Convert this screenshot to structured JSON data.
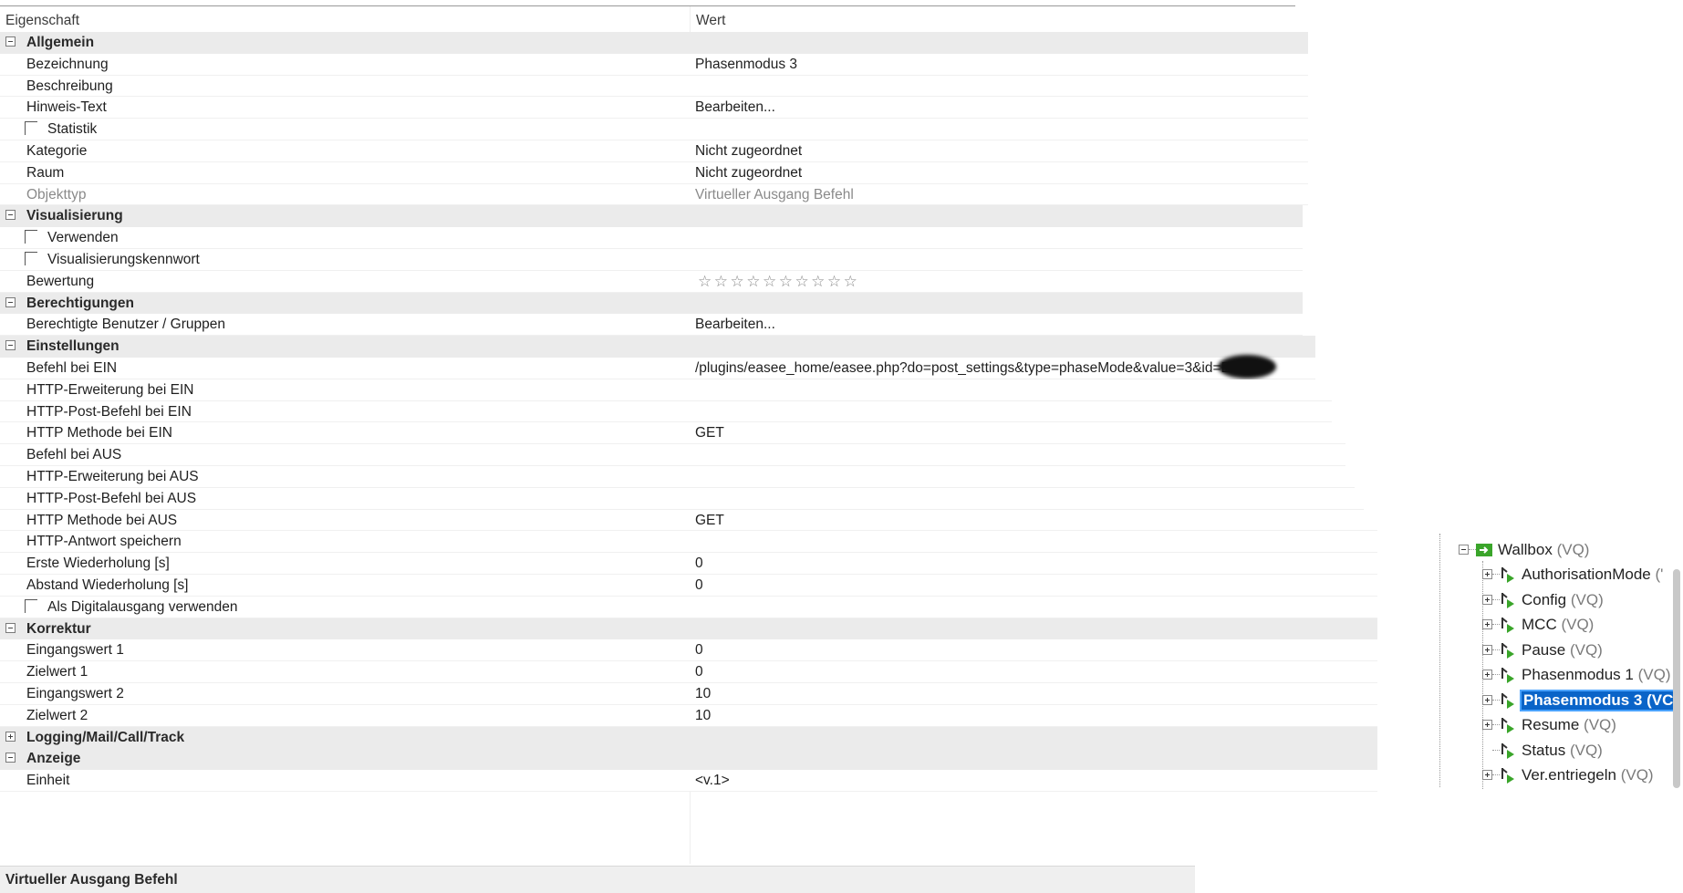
{
  "header": {
    "col_property": "Eigenschaft",
    "col_value": "Wert"
  },
  "rows": [
    {
      "type": "section",
      "label": "Allgemein",
      "expanded": true
    },
    {
      "type": "prop",
      "label": "Bezeichnung",
      "value": "Phasenmodus 3"
    },
    {
      "type": "prop",
      "label": "Beschreibung",
      "value": ""
    },
    {
      "type": "prop",
      "label": "Hinweis-Text",
      "value": "Bearbeiten..."
    },
    {
      "type": "check",
      "label": "Statistik",
      "value": ""
    },
    {
      "type": "prop",
      "label": "Kategorie",
      "value": "Nicht zugeordnet"
    },
    {
      "type": "prop",
      "label": "Raum",
      "value": "Nicht zugeordnet"
    },
    {
      "type": "prop",
      "label": "Objekttyp",
      "value": "Virtueller Ausgang Befehl",
      "disabled": true
    },
    {
      "type": "section",
      "label": "Visualisierung",
      "expanded": true
    },
    {
      "type": "check",
      "label": "Verwenden",
      "value": ""
    },
    {
      "type": "check",
      "label": "Visualisierungskennwort",
      "value": ""
    },
    {
      "type": "rating",
      "label": "Bewertung",
      "value": "☆☆☆☆☆☆☆☆☆☆"
    },
    {
      "type": "section",
      "label": "Berechtigungen",
      "expanded": true
    },
    {
      "type": "prop",
      "label": "Berechtigte Benutzer / Gruppen",
      "value": "Bearbeiten..."
    },
    {
      "type": "section",
      "label": "Einstellungen",
      "expanded": true
    },
    {
      "type": "prop",
      "label": "Befehl bei EIN",
      "value": "/plugins/easee_home/easee.php?do=post_settings&type=phaseMode&value=3&id=EH",
      "redacted": true
    },
    {
      "type": "prop",
      "label": "HTTP-Erweiterung bei EIN",
      "value": ""
    },
    {
      "type": "prop",
      "label": "HTTP-Post-Befehl bei EIN",
      "value": ""
    },
    {
      "type": "prop",
      "label": "HTTP Methode bei EIN",
      "value": "GET"
    },
    {
      "type": "prop",
      "label": "Befehl bei AUS",
      "value": ""
    },
    {
      "type": "prop",
      "label": "HTTP-Erweiterung bei AUS",
      "value": ""
    },
    {
      "type": "prop",
      "label": "HTTP-Post-Befehl bei AUS",
      "value": ""
    },
    {
      "type": "prop",
      "label": "HTTP Methode bei AUS",
      "value": "GET"
    },
    {
      "type": "prop",
      "label": "HTTP-Antwort speichern",
      "value": ""
    },
    {
      "type": "prop",
      "label": "Erste Wiederholung [s]",
      "value": "0"
    },
    {
      "type": "prop",
      "label": "Abstand Wiederholung [s]",
      "value": "0"
    },
    {
      "type": "check",
      "label": "Als Digitalausgang verwenden",
      "value": ""
    },
    {
      "type": "section",
      "label": "Korrektur",
      "expanded": true
    },
    {
      "type": "prop",
      "label": "Eingangswert 1",
      "value": "0"
    },
    {
      "type": "prop",
      "label": "Zielwert 1",
      "value": "0"
    },
    {
      "type": "prop",
      "label": "Eingangswert 2",
      "value": "10"
    },
    {
      "type": "prop",
      "label": "Zielwert 2",
      "value": "10"
    },
    {
      "type": "section",
      "label": "Logging/Mail/Call/Track",
      "expanded": false
    },
    {
      "type": "section",
      "label": "Anzeige",
      "expanded": true
    },
    {
      "type": "prop",
      "label": "Einheit",
      "value": "<v.1>"
    }
  ],
  "status_bar": {
    "text": "Virtueller Ausgang Befehl"
  },
  "tree": {
    "root": {
      "label": "Wallbox",
      "suffix": "(VQ)"
    },
    "items": [
      {
        "label": "AuthorisationMode",
        "suffix": "('",
        "expandable": true
      },
      {
        "label": "Config",
        "suffix": "(VQ)",
        "expandable": true
      },
      {
        "label": "MCC",
        "suffix": "(VQ)",
        "expandable": true
      },
      {
        "label": "Pause",
        "suffix": "(VQ)",
        "expandable": true
      },
      {
        "label": "Phasenmodus 1",
        "suffix": "(VQ)",
        "expandable": true
      },
      {
        "label": "Phasenmodus 3",
        "suffix": "(VC",
        "expandable": true,
        "selected": true
      },
      {
        "label": "Resume",
        "suffix": "(VQ)",
        "expandable": true
      },
      {
        "label": "Status",
        "suffix": "(VQ)",
        "expandable": false
      },
      {
        "label": "Ver.entriegeln",
        "suffix": "(VQ)",
        "expandable": true
      }
    ]
  },
  "colors": {
    "selection": "#0a64c8",
    "section_bg": "#ebebeb",
    "icon_green": "#3aa52a"
  }
}
